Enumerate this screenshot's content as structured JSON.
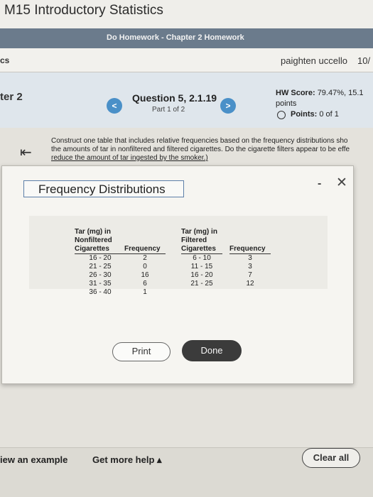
{
  "course": {
    "title": "M15 Introductory Statistics"
  },
  "homework": {
    "title": "Do Homework - Chapter 2 Homework"
  },
  "user_bar": {
    "left_crumb": "cs",
    "user_name": "paighten uccello",
    "date": "10/"
  },
  "question": {
    "chapter_label": "ter 2",
    "title": "Question 5, 2.1.19",
    "part": "Part 1 of 2",
    "prev_icon": "chevron-left-icon",
    "next_icon": "chevron-right-icon",
    "hw_score_label": "HW Score:",
    "hw_score_value": "79.47%, 15.1",
    "hw_score_unit": "points",
    "points_label": "Points:",
    "points_value": "0 of 1"
  },
  "instructions": {
    "line1": "Construct one table that includes relative frequencies based on the frequency distributions sho",
    "line2": "the amounts of tar in nonfiltered and filtered cigarettes. Do the cigarette filters appear to be effe",
    "line3": "reduce the amount of tar ingested by the smoker.)"
  },
  "dialog": {
    "title": "Frequency Distributions",
    "minimize": "-",
    "close": "✕",
    "print_label": "Print",
    "done_label": "Done"
  },
  "table": {
    "nonfiltered_header": [
      "Tar (mg) in",
      "Nonfiltered",
      "Cigarettes"
    ],
    "nonfiltered_freq_header": "Frequency",
    "nonfiltered_classes": [
      "16 - 20",
      "21 - 25",
      "26 - 30",
      "31 - 35",
      "36 - 40"
    ],
    "nonfiltered_freqs": [
      "2",
      "0",
      "16",
      "6",
      "1"
    ],
    "filtered_header": [
      "Tar (mg) in",
      "Filtered",
      "Cigarettes"
    ],
    "filtered_freq_header": "Frequency",
    "filtered_classes": [
      "6 - 10",
      "11 - 15",
      "16 - 20",
      "21 - 25"
    ],
    "filtered_freqs": [
      "3",
      "3",
      "7",
      "12"
    ]
  },
  "footer": {
    "view_example": "iew an example",
    "more_help": "Get more help ▴",
    "clear_all": "Clear all"
  }
}
